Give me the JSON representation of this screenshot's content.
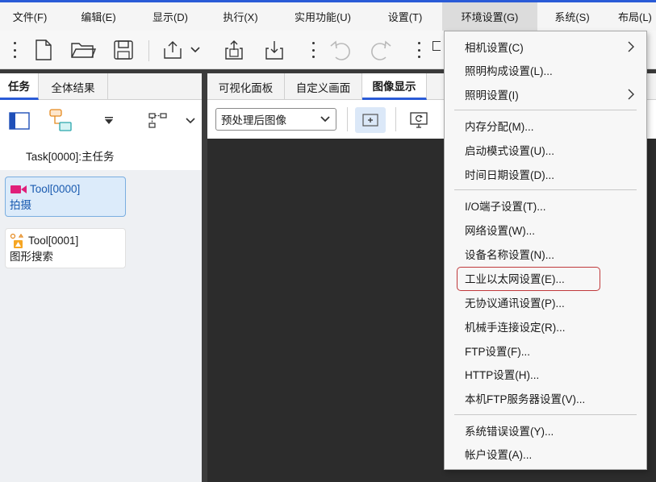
{
  "menubar": {
    "items": [
      {
        "label": "文件(F)"
      },
      {
        "label": "编辑(E)"
      },
      {
        "label": "显示(D)"
      },
      {
        "label": "执行(X)"
      },
      {
        "label": "实用功能(U)"
      },
      {
        "label": "设置(T)"
      },
      {
        "label": "环境设置(G)"
      },
      {
        "label": "系统(S)"
      },
      {
        "label": "布局(L)"
      }
    ]
  },
  "left_panel": {
    "tabs": [
      {
        "label": "任务"
      },
      {
        "label": "全体结果"
      }
    ],
    "task_label": "Task[0000]:主任务",
    "tools": [
      {
        "name": "Tool[0000]",
        "desc": "拍摄"
      },
      {
        "name": "Tool[0001]",
        "desc": "图形搜索"
      }
    ]
  },
  "right_panel": {
    "tabs": [
      {
        "label": "可视化面板"
      },
      {
        "label": "自定义画面"
      },
      {
        "label": "图像显示"
      }
    ],
    "image_select": "预处理后图像"
  },
  "env_menu": {
    "items": [
      {
        "label": "相机设置(C)",
        "submenu": true
      },
      {
        "label": "照明构成设置(L)..."
      },
      {
        "label": "照明设置(I)",
        "submenu": true
      },
      {
        "label": "内存分配(M)..."
      },
      {
        "label": "启动模式设置(U)..."
      },
      {
        "label": "时间日期设置(D)..."
      },
      {
        "label": "I/O端子设置(T)..."
      },
      {
        "label": "网络设置(W)..."
      },
      {
        "label": "设备名称设置(N)..."
      },
      {
        "label": "工业以太网设置(E)...",
        "highlighted": true
      },
      {
        "label": "无协议通讯设置(P)..."
      },
      {
        "label": "机械手连接设定(R)..."
      },
      {
        "label": "FTP设置(F)..."
      },
      {
        "label": "HTTP设置(H)..."
      },
      {
        "label": "本机FTP服务器设置(V)..."
      },
      {
        "label": "系统错误设置(Y)..."
      },
      {
        "label": "帐户设置(A)..."
      }
    ]
  },
  "colors": {
    "accent": "#2a5bd7",
    "highlight_border": "#c0393b",
    "canvas_bg": "#2c2c2c",
    "selected_tool_bg": "#dcebfa"
  }
}
